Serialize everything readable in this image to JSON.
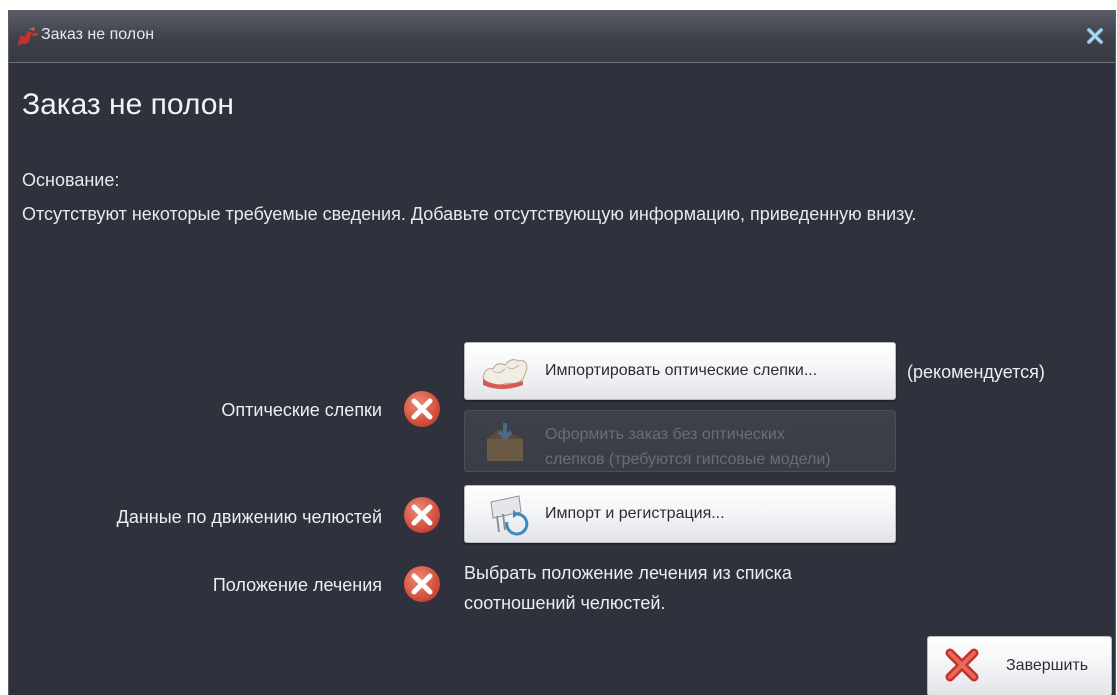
{
  "window": {
    "title": "Заказ не полон",
    "close_icon": "close-icon",
    "accent_color": "#7fb7d9"
  },
  "main": {
    "heading": "Заказ не полон",
    "reason_label": "Основание:",
    "reason_text": "Отсутствуют некоторые требуемые сведения. Добавьте отсутствующую информацию, приведенную внизу."
  },
  "rows": {
    "optical": {
      "label": "Оптические слепки",
      "status_icon": "error-x-icon",
      "import_button": "Импортировать оптические слепки...",
      "recommended": "(рекомендуется)",
      "no_optical_button": "Оформить заказ без оптических слепков (требуются гипсовые модели)",
      "no_optical_line1": "Оформить заказ без оптических",
      "no_optical_line2": "слепков (требуются гипсовые модели)"
    },
    "jaw_motion": {
      "label": "Данные по движению челюстей",
      "status_icon": "error-x-icon",
      "button": "Импорт и регистрация..."
    },
    "treatment": {
      "label": "Положение лечения",
      "status_icon": "error-x-icon",
      "text_line1": "Выбрать положение лечения из списка",
      "text_line2": "соотношений челюстей."
    }
  },
  "footer": {
    "finish_button": "Завершить"
  },
  "colors": {
    "background": "#2f323c",
    "error": "#d9533c",
    "button": "#f3f4f6"
  }
}
